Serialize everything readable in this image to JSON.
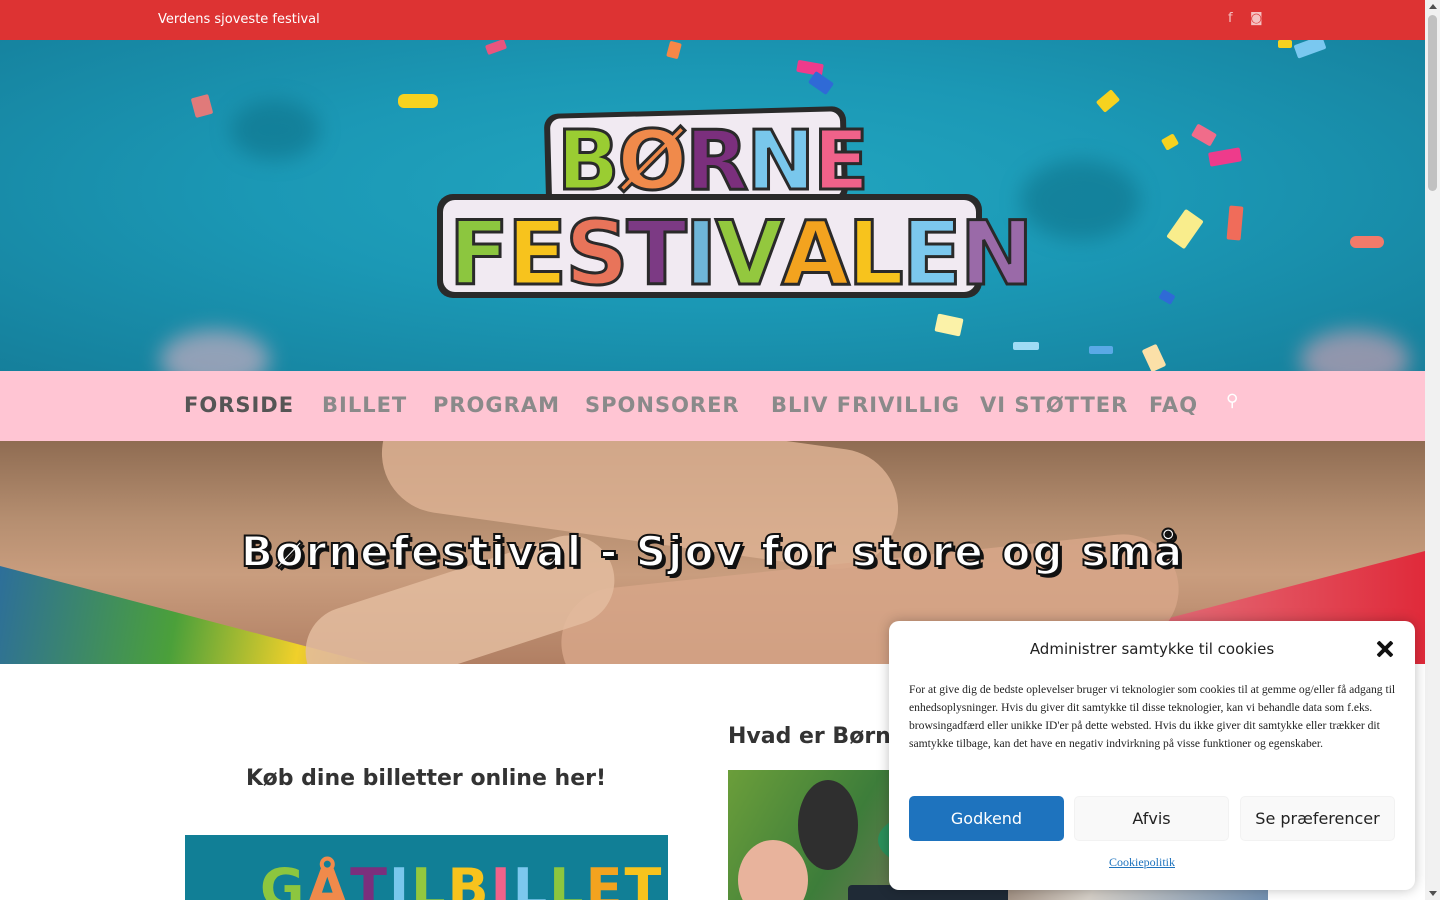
{
  "topbar": {
    "tagline": "Verdens sjoveste festival",
    "social_icons": [
      "facebook-icon",
      "instagram-icon"
    ],
    "facebook_glyph": "f",
    "instagram_glyph": "◙",
    "background": "#dd3333"
  },
  "logo": {
    "line1": [
      "B",
      "Ø",
      "R",
      "N",
      "E"
    ],
    "line1_colors": [
      "#9acd32",
      "#f08a4b",
      "#7b2f7d",
      "#79c7ec",
      "#f0628a"
    ],
    "line2": [
      "F",
      "E",
      "S",
      "T",
      "I",
      "V",
      "A",
      "L",
      "E",
      "N"
    ],
    "line2_colors": [
      "#8cc63f",
      "#f7c31d",
      "#e8745a",
      "#7c3a84",
      "#6fb6d8",
      "#93c83e",
      "#f3a31f",
      "#f7c31d",
      "#7cc8ee",
      "#9a6aa8"
    ]
  },
  "nav": {
    "items": [
      "FORSIDE",
      "BILLET",
      "PROGRAM",
      "SPONSORER",
      "BLIV FRIVILLIG",
      "VI STØTTER",
      "FAQ"
    ],
    "active_index": 0,
    "search_glyph": "⚲",
    "background": "#ffc5d3"
  },
  "banner": {
    "title": "Børnefestival - Sjov for store og små"
  },
  "content": {
    "buy_heading": "Køb dine billetter online her!",
    "ticket_box_text": [
      "G",
      "Å",
      " ",
      "T",
      "I",
      "L",
      " ",
      "B",
      "I",
      "L",
      "L",
      "E",
      "T"
    ],
    "ticket_box_colors": [
      "#8cc63f",
      "#f08a4b",
      "#fff",
      "#7b2f7d",
      "#79c7ec",
      "#93c83e",
      "#fff",
      "#f7c31d",
      "#f0628a",
      "#7cc8ee",
      "#8cc63f",
      "#f3a31f",
      "#f7c31d"
    ],
    "what_heading": "Hvad er Børn"
  },
  "cookie": {
    "title": "Administrer samtykke til cookies",
    "body": "For at give dig de bedste oplevelser bruger vi teknologier som cookies til at gemme og/eller få adgang til enhedsoplysninger. Hvis du giver dit samtykke til disse teknologier, kan vi behandle data som f.eks. browsingadfærd eller unikke ID'er på dette websted. Hvis du ikke giver dit samtykke eller trækker dit samtykke tilbage, kan det have en negativ indvirkning på visse funktioner og egenskaber.",
    "accept": "Godkend",
    "deny": "Afvis",
    "preferences": "Se præferencer",
    "policy_link": "Cookiepolitik",
    "accent": "#1e73be"
  }
}
